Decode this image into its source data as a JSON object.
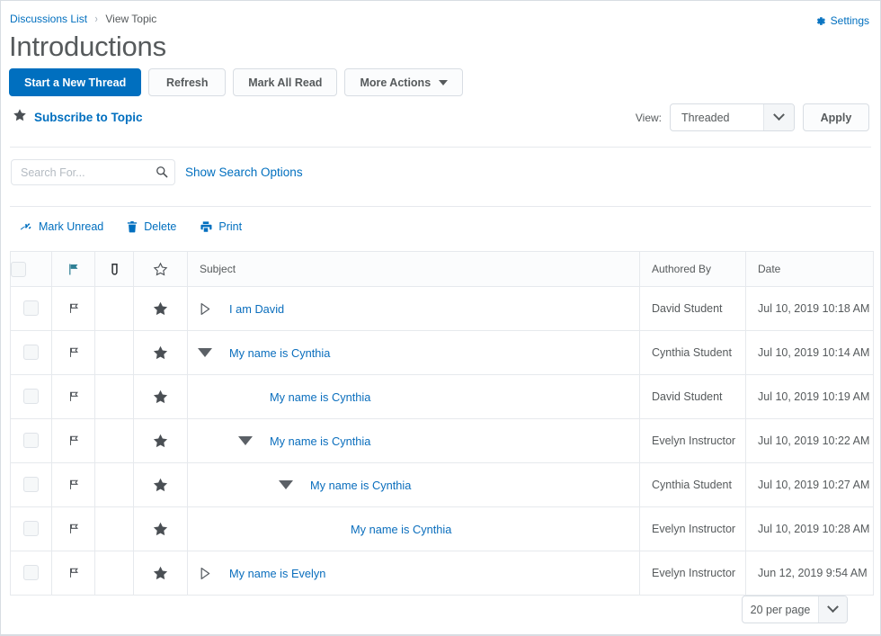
{
  "breadcrumb": {
    "list_link": "Discussions List",
    "separator": "›",
    "current": "View Topic"
  },
  "settings": {
    "label": "Settings",
    "icon": "gear-icon"
  },
  "header": {
    "title": "Introductions"
  },
  "toolbar": {
    "new_thread": "Start a New Thread",
    "refresh": "Refresh",
    "mark_all_read": "Mark All Read",
    "more_actions": "More Actions"
  },
  "subscribe": {
    "label": "Subscribe to Topic",
    "icon": "star-icon"
  },
  "view": {
    "label": "View:",
    "selected": "Threaded",
    "options": [
      "Threaded"
    ],
    "apply": "Apply"
  },
  "search": {
    "placeholder": "Search For...",
    "value": "",
    "icon": "search-icon",
    "show_options": "Show Search Options"
  },
  "mini_toolbar": {
    "mark_unread": "Mark Unread",
    "delete": "Delete",
    "print": "Print"
  },
  "table": {
    "columns": {
      "checkbox": "",
      "flag": "flag-icon",
      "attachment": "paperclip-icon",
      "star": "star-outline-icon",
      "subject": "Subject",
      "author": "Authored By",
      "date": "Date"
    },
    "rows": [
      {
        "subject": "I am David",
        "author": "David Student",
        "date": "Jul 10, 2019 10:18 AM",
        "indent": 0,
        "toggle": "collapsed",
        "starred": true,
        "flagged": true
      },
      {
        "subject": "My name is Cynthia",
        "author": "Cynthia Student",
        "date": "Jul 10, 2019 10:14 AM",
        "indent": 0,
        "toggle": "expanded",
        "starred": true,
        "flagged": true
      },
      {
        "subject": "My name is Cynthia",
        "author": "David Student",
        "date": "Jul 10, 2019 10:19 AM",
        "indent": 1,
        "toggle": "none",
        "starred": true,
        "flagged": true
      },
      {
        "subject": "My name is Cynthia",
        "author": "Evelyn Instructor",
        "date": "Jul 10, 2019 10:22 AM",
        "indent": 1,
        "toggle": "expanded",
        "starred": true,
        "flagged": true
      },
      {
        "subject": "My name is Cynthia",
        "author": "Cynthia Student",
        "date": "Jul 10, 2019 10:27 AM",
        "indent": 2,
        "toggle": "expanded",
        "starred": true,
        "flagged": true
      },
      {
        "subject": "My name is Cynthia",
        "author": "Evelyn Instructor",
        "date": "Jul 10, 2019 10:28 AM",
        "indent": 3,
        "toggle": "none",
        "starred": true,
        "flagged": true
      },
      {
        "subject": "My name is Evelyn",
        "author": "Evelyn Instructor",
        "date": "Jun 12, 2019 9:54 AM",
        "indent": 0,
        "toggle": "collapsed",
        "starred": true,
        "flagged": true
      }
    ]
  },
  "pagination": {
    "per_page": "20 per page",
    "options": [
      "20 per page"
    ]
  },
  "colors": {
    "primary": "#006fbf",
    "link": "#0a6ebd",
    "text": "#565a5c",
    "border": "#e6e9ed",
    "header_bg": "#fbfcfd",
    "flag_header": "#2f7f95"
  }
}
